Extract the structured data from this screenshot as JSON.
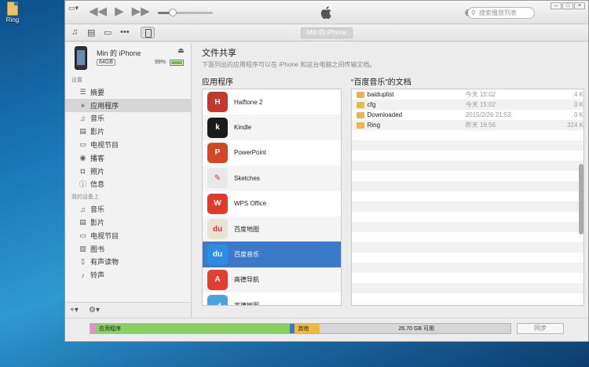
{
  "desktop": {
    "icon_label": "Ring"
  },
  "titlebar": {
    "search_placeholder": "搜索播放列表"
  },
  "toolbar": {
    "device_tab": "Min 的 iPhone"
  },
  "device": {
    "name": "Min 的 iPhone",
    "capacity": "64GB",
    "battery_pct": "99%"
  },
  "sidebar": {
    "settings_label": "设置",
    "settings_items": [
      {
        "label": "摘要",
        "icon": "summary-icon"
      },
      {
        "label": "应用程序",
        "icon": "apps-icon"
      },
      {
        "label": "音乐",
        "icon": "music-icon"
      },
      {
        "label": "影片",
        "icon": "film-icon"
      },
      {
        "label": "电视节目",
        "icon": "tv-icon"
      },
      {
        "label": "播客",
        "icon": "podcast-icon"
      },
      {
        "label": "照片",
        "icon": "camera-icon"
      },
      {
        "label": "信息",
        "icon": "info-icon"
      }
    ],
    "ondevice_label": "我的设备上",
    "ondevice_items": [
      {
        "label": "音乐",
        "icon": "music-icon"
      },
      {
        "label": "影片",
        "icon": "film-icon"
      },
      {
        "label": "电视节目",
        "icon": "tv-icon"
      },
      {
        "label": "图书",
        "icon": "book-icon"
      },
      {
        "label": "有声读物",
        "icon": "audiobook-icon"
      },
      {
        "label": "铃声",
        "icon": "bell-icon"
      }
    ]
  },
  "main": {
    "title": "文件共享",
    "subtitle": "下面列出的应用程序可以在 iPhone 和这台电脑之间传输文档。",
    "apps_header": "应用程序",
    "docs_header": "“百度音乐”的文档",
    "apps": [
      {
        "name": "Halftone 2",
        "color": "#c0392b"
      },
      {
        "name": "Kindle",
        "color": "#1a1a1a"
      },
      {
        "name": "PowerPoint",
        "color": "#d24726"
      },
      {
        "name": "Sketches",
        "color": "#e8e8e8"
      },
      {
        "name": "WPS Office",
        "color": "#e03a2a"
      },
      {
        "name": "百度地图",
        "color": "#e9e3d3"
      },
      {
        "name": "百度音乐",
        "color": "#2c8de4"
      },
      {
        "name": "高德导航",
        "color": "#e04033"
      },
      {
        "name": "高德地图",
        "color": "#4aa3df"
      }
    ],
    "documents": [
      {
        "name": "baiduplist",
        "date": "今天 15:02",
        "size": "4 K"
      },
      {
        "name": "cfg",
        "date": "今天 15:02",
        "size": "0 K"
      },
      {
        "name": "Downloaded",
        "date": "2015/2/26 21:53",
        "size": "0 K"
      },
      {
        "name": "Ring",
        "date": "昨天 16:56",
        "size": "324 K"
      }
    ]
  },
  "storage": {
    "segments": [
      {
        "label": "",
        "color": "#e58fcf",
        "fraction": 0.006
      },
      {
        "label": "应用程序",
        "color": "#85d35e",
        "fraction": 0.472
      },
      {
        "label": "",
        "color": "#3a78c2",
        "fraction": 0.004
      },
      {
        "label": "其他",
        "color": "#f5b835",
        "fraction": 0.053
      },
      {
        "label": "26.70 GB 可用",
        "color": "#d6d6d6",
        "fraction": 0.465
      }
    ],
    "sync_label": "同步"
  }
}
